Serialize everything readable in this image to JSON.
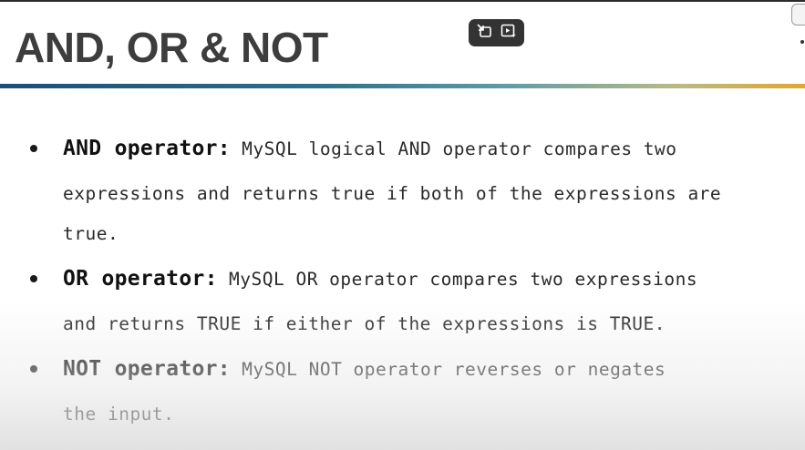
{
  "slide": {
    "title": "AND, OR & NOT"
  },
  "bullets": [
    {
      "term": "AND operator:",
      "line1": " MySQL logical AND operator compares two",
      "line2": "expressions and returns true if both of the expressions are",
      "line3": "true."
    },
    {
      "term": "OR operator:",
      "line1": " MySQL OR operator compares two expressions",
      "line2": "and returns TRUE if either of the expressions is TRUE."
    },
    {
      "term": "NOT operator:",
      "line1": " MySQL NOT operator reverses or negates",
      "line2": "the input."
    }
  ],
  "controls": {
    "left_icon": "pip-exit-icon",
    "right_icon": "video-sparkle-icon"
  },
  "colors": {
    "title": "#3d3d3d",
    "rule_start": "#1c4f72",
    "rule_end": "#e0a830",
    "controls_bg": "#333333"
  }
}
